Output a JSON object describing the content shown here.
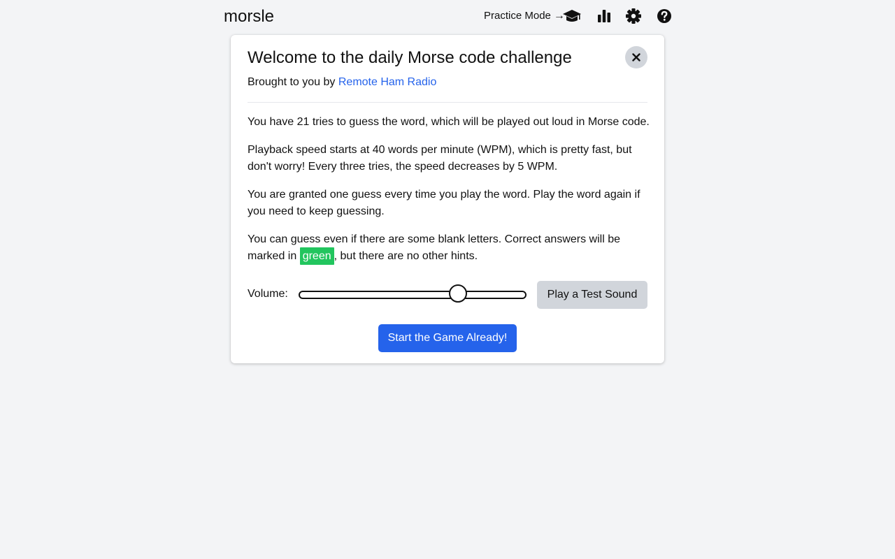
{
  "app": {
    "title": "morsle"
  },
  "header": {
    "practice_label": "Practice Mode",
    "practice_arrow": "→",
    "icons": [
      "graduation-cap-icon",
      "chart-bar-icon",
      "gear-icon",
      "question-icon"
    ]
  },
  "modal": {
    "title": "Welcome to the daily Morse code challenge",
    "subtitle_prefix": "Brought to you by ",
    "subtitle_link": "Remote Ham Radio",
    "paragraphs": {
      "p1": "You have 21 tries to guess the word, which will be played out loud in Morse code.",
      "p2": "Playback speed starts at 40 words per minute (WPM), which is pretty fast, but don't worry! Every three tries, the speed decreases by 5 WPM.",
      "p3": "You are granted one guess every time you play the word. Play the word again if you need to keep guessing.",
      "p4_before": "You can guess even if there are some blank letters. Correct answers will be marked in ",
      "p4_highlight": "green",
      "p4_after": ", but there are no other hints."
    },
    "volume_label": "Volume:",
    "volume_value": 0.7,
    "test_sound_label": "Play a Test Sound",
    "start_label": "Start the Game Already!"
  },
  "colors": {
    "background": "#f3f4f6",
    "link": "#2563eb",
    "primary_button": "#2563eb",
    "highlight_green": "#22c55e",
    "secondary_button": "#d1d5db"
  }
}
